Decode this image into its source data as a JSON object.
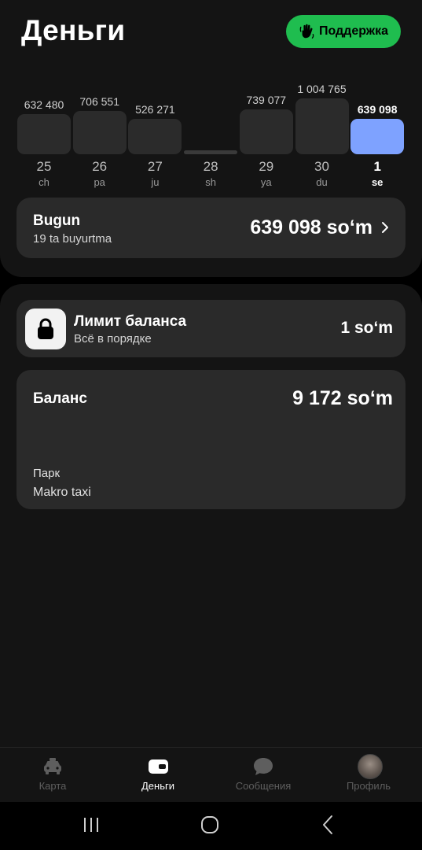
{
  "header": {
    "title": "Деньги",
    "support_label": "Поддержка"
  },
  "chart_data": {
    "type": "bar",
    "categories": [
      "25",
      "26",
      "27",
      "28",
      "29",
      "30",
      "1"
    ],
    "day_names": [
      "ch",
      "pa",
      "ju",
      "sh",
      "ya",
      "du",
      "se"
    ],
    "values": [
      632480,
      706551,
      526271,
      0,
      739077,
      1004765,
      639098
    ],
    "value_labels": [
      "632 480",
      "706 551",
      "526 271",
      "",
      "739 077",
      "1 004 765",
      "639 098"
    ],
    "active_index": 6,
    "ylim": [
      0,
      1004765
    ],
    "colors": {
      "bar": "#2b2b2b",
      "active": "#7ea2ff"
    }
  },
  "today": {
    "title": "Bugun",
    "subtitle": "19 ta buyurtma",
    "amount": "639 098 so‘m"
  },
  "limit": {
    "title": "Лимит баланса",
    "subtitle": "Всё в порядке",
    "amount": "1 so‘m"
  },
  "balance": {
    "title": "Баланс",
    "amount": "9 172 so‘m",
    "park_label": "Парк",
    "park_name": "Makro taxi"
  },
  "nav": {
    "items": [
      {
        "label": "Карта",
        "icon": "taxi-car-icon",
        "active": false
      },
      {
        "label": "Деньги",
        "icon": "wallet-icon",
        "active": true
      },
      {
        "label": "Сообщения",
        "icon": "chat-bubble-icon",
        "active": false
      },
      {
        "label": "Профиль",
        "icon": "avatar",
        "active": false
      }
    ]
  },
  "colors": {
    "accent_green": "#1fbd4f",
    "accent_blue": "#7ea2ff",
    "card": "#2a2a2a",
    "panel": "#141414"
  }
}
